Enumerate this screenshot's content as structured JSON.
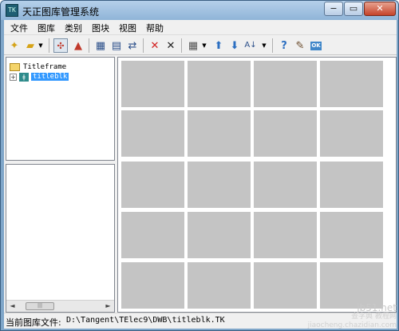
{
  "window": {
    "title": "天正图库管理系统"
  },
  "app_icon": {
    "text": "TK"
  },
  "controls": {
    "minimize": "−",
    "maximize": "▭",
    "close": "✕"
  },
  "menu": [
    "文件",
    "图库",
    "类别",
    "图块",
    "视图",
    "帮助"
  ],
  "tree": {
    "root_label": "Titleframe",
    "child_label": "titleblk",
    "expander": "+"
  },
  "scrollbar": {
    "left": "◄",
    "right": "►",
    "thumb": "|||"
  },
  "status": {
    "label": "当前图库文件:",
    "path": "D:\\Tangent\\TElec9\\DWB\\titleblk.TK"
  },
  "watermark": {
    "site": "jb51.net",
    "line1": "查字典 教程网",
    "line2": "jiaocheng.chazidian.com"
  },
  "toolbar_icons": [
    "new-icon",
    "open-icon",
    "select-icon",
    "triangle-icon",
    "library-icon",
    "paste-icon",
    "swap-icon",
    "delete-icon",
    "delete-all-icon",
    "grid-icon",
    "arrow-up-icon",
    "arrow-down-icon",
    "sort-icon",
    "help-icon",
    "edit-icon",
    "ok-icon"
  ],
  "colors": {
    "accent": "#3399ff",
    "thumb": "#c4c4c4",
    "close": "#c5442b"
  }
}
